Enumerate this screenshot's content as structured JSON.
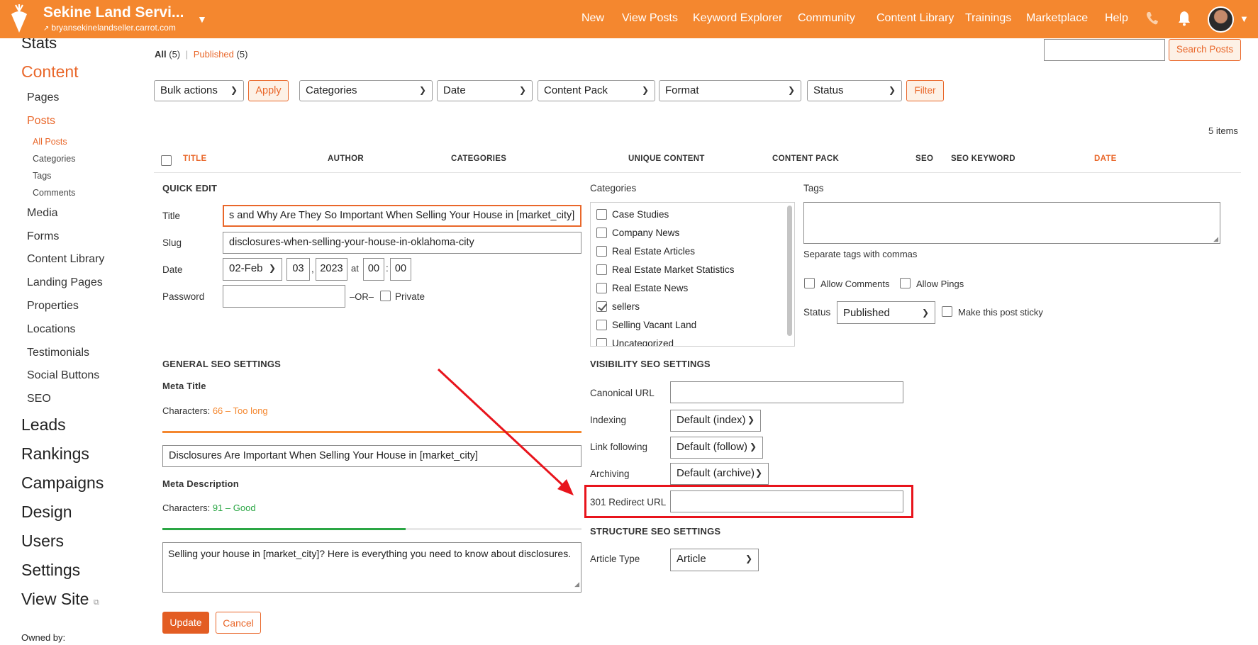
{
  "header": {
    "site_name": "Sekine Land Servi...",
    "site_url": "bryansekinelandseller.carrot.com",
    "nav": [
      "New",
      "View Posts",
      "Keyword Explorer",
      "Community",
      "Content Library",
      "Trainings",
      "Marketplace",
      "Help"
    ],
    "icons": [
      "carrot-logo-icon",
      "phone-icon",
      "bell-icon",
      "avatar"
    ]
  },
  "sidebar": {
    "stats": "Stats",
    "content": "Content",
    "pages": "Pages",
    "posts": "Posts",
    "posts_sub": [
      "All Posts",
      "Categories",
      "Tags",
      "Comments"
    ],
    "content_items": [
      "Media",
      "Forms",
      "Content Library",
      "Landing Pages",
      "Properties",
      "Locations",
      "Testimonials",
      "Social Buttons",
      "SEO"
    ],
    "main_items": [
      "Leads",
      "Rankings",
      "Campaigns",
      "Design",
      "Users",
      "Settings",
      "View Site"
    ],
    "owned_by": "Owned by:"
  },
  "filters": {
    "all_label": "All",
    "all_count": "(5)",
    "published_label": "Published",
    "published_count": "(5)",
    "search_button": "Search Posts",
    "bulk_actions": "Bulk actions",
    "apply": "Apply",
    "categories": "Categories",
    "date": "Date",
    "content_pack": "Content Pack",
    "format": "Format",
    "status": "Status",
    "filter": "Filter",
    "items_count": "5 items"
  },
  "table": {
    "columns": [
      "TITLE",
      "AUTHOR",
      "CATEGORIES",
      "UNIQUE CONTENT",
      "CONTENT PACK",
      "SEO",
      "SEO KEYWORD",
      "DATE"
    ]
  },
  "quick_edit": {
    "heading": "QUICK EDIT",
    "title_label": "Title",
    "title_value": "s and Why Are They So Important When Selling Your House in [market_city]",
    "slug_label": "Slug",
    "slug_value": "disclosures-when-selling-your-house-in-oklahoma-city",
    "date_label": "Date",
    "month": "02-Feb",
    "day": "03",
    "year": "2023",
    "at": "at",
    "hour": "00",
    "minute": "00",
    "password_label": "Password",
    "or": "–OR–",
    "private": "Private",
    "categories_heading": "Categories",
    "categories": [
      {
        "label": "Case Studies",
        "checked": false
      },
      {
        "label": "Company News",
        "checked": false
      },
      {
        "label": "Real Estate Articles",
        "checked": false
      },
      {
        "label": "Real Estate Market Statistics",
        "checked": false
      },
      {
        "label": "Real Estate News",
        "checked": false
      },
      {
        "label": "sellers",
        "checked": true
      },
      {
        "label": "Selling Vacant Land",
        "checked": false
      },
      {
        "label": "Uncategorized",
        "checked": false
      }
    ],
    "tags_heading": "Tags",
    "tags_hint": "Separate tags with commas",
    "allow_comments": "Allow Comments",
    "allow_pings": "Allow Pings",
    "status_label": "Status",
    "status_value": "Published",
    "sticky": "Make this post sticky"
  },
  "seo_general": {
    "heading": "GENERAL SEO SETTINGS",
    "meta_title_label": "Meta Title",
    "meta_title_chars_label": "Characters:",
    "meta_title_chars": "66 – Too long",
    "meta_title_progress": 1.0,
    "meta_title_value": "Disclosures Are Important When Selling Your House in [market_city]",
    "meta_desc_label": "Meta Description",
    "meta_desc_chars_label": "Characters:",
    "meta_desc_chars": "91 – Good",
    "meta_desc_progress": 0.58,
    "meta_desc_value": "Selling your house in [market_city]? Here is everything you need to know about disclosures.",
    "colors": {
      "too_long": "#f4872f",
      "good": "#2aa644"
    }
  },
  "seo_visibility": {
    "heading": "VISIBILITY SEO SETTINGS",
    "canonical_label": "Canonical URL",
    "indexing_label": "Indexing",
    "indexing_value": "Default (index)",
    "link_label": "Link following",
    "link_value": "Default (follow)",
    "archiving_label": "Archiving",
    "archiving_value": "Default (archive)",
    "redirect_label": "301 Redirect URL"
  },
  "seo_structure": {
    "heading": "STRUCTURE SEO SETTINGS",
    "article_type_label": "Article Type",
    "article_type_value": "Article"
  },
  "actions": {
    "update": "Update",
    "cancel": "Cancel"
  },
  "theme": {
    "brand": "#f4872f",
    "accent_text": "#e9672a",
    "annotation": "#e8141c"
  }
}
